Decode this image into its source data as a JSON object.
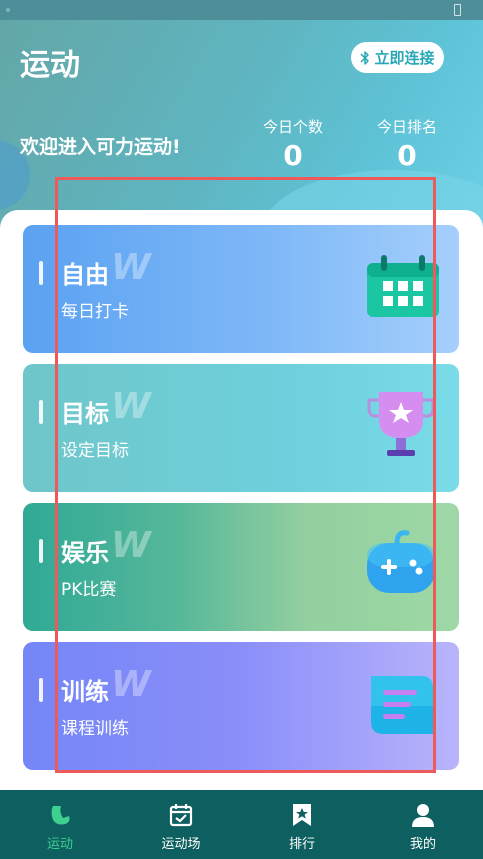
{
  "header": {
    "title": "运动",
    "connect_label": "立即连接",
    "welcome": "欢迎进入可力运动!",
    "stats": [
      {
        "label": "今日个数",
        "value": "0"
      },
      {
        "label": "今日排名",
        "value": "0"
      }
    ]
  },
  "cards": [
    {
      "title": "自由",
      "subtitle": "每日打卡",
      "icon": "calendar-icon",
      "watermark": "W"
    },
    {
      "title": "目标",
      "subtitle": "设定目标",
      "icon": "trophy-icon",
      "watermark": "W"
    },
    {
      "title": "娱乐",
      "subtitle": "PK比赛",
      "icon": "gamepad-icon",
      "watermark": "W"
    },
    {
      "title": "训练",
      "subtitle": "课程训练",
      "icon": "notebook-icon",
      "watermark": "W"
    }
  ],
  "nav": {
    "items": [
      {
        "label": "运动",
        "icon": "arm-icon",
        "active": true
      },
      {
        "label": "运动场",
        "icon": "calendar-check-icon",
        "active": false
      },
      {
        "label": "排行",
        "icon": "bookmark-star-icon",
        "active": false
      },
      {
        "label": "我的",
        "icon": "user-icon",
        "active": false
      }
    ]
  },
  "colors": {
    "accent": "#3dd08f",
    "nav_bg": "#0e5f5f",
    "highlight": "#ee5a5a",
    "connect_text": "#2aa7b6"
  }
}
